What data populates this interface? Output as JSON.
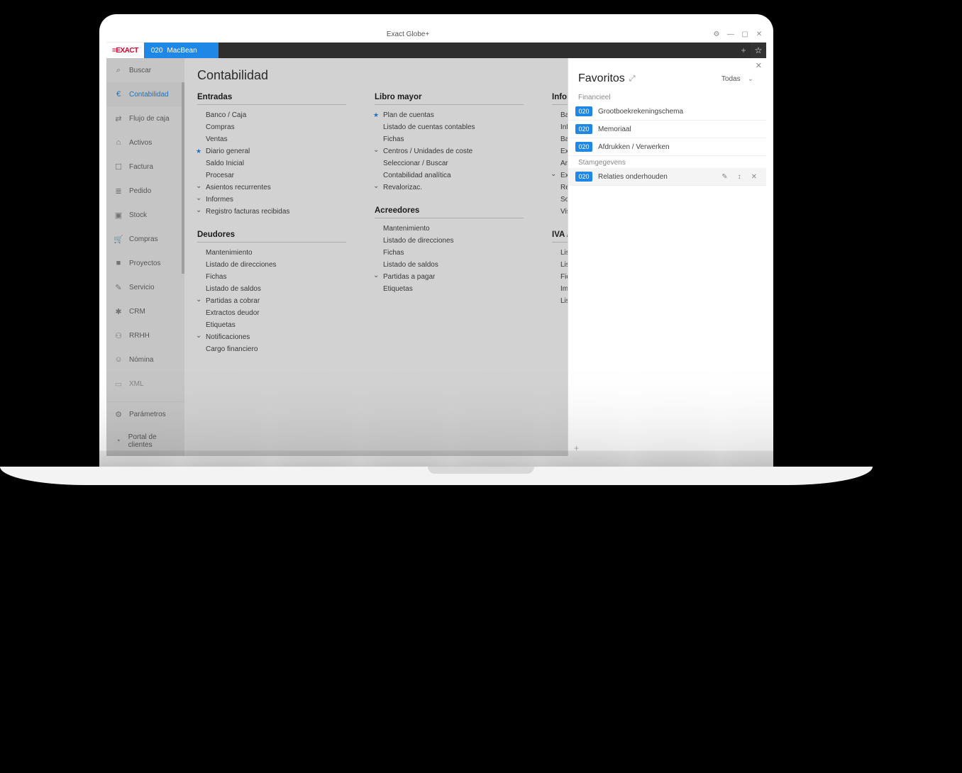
{
  "window": {
    "title": "Exact Globe+",
    "brand": "=EXACT",
    "tab_code": "020",
    "tab_name": "MacBean"
  },
  "sidebar": {
    "search": "Buscar",
    "items": [
      {
        "label": "Contabilidad",
        "icon": "€"
      },
      {
        "label": "Flujo de caja",
        "icon": "⇄"
      },
      {
        "label": "Activos",
        "icon": "⌂"
      },
      {
        "label": "Factura",
        "icon": "☐"
      },
      {
        "label": "Pedido",
        "icon": "≣"
      },
      {
        "label": "Stock",
        "icon": "▣"
      },
      {
        "label": "Compras",
        "icon": "🛒"
      },
      {
        "label": "Proyectos",
        "icon": "■"
      },
      {
        "label": "Servicio",
        "icon": "✎"
      },
      {
        "label": "CRM",
        "icon": "✱"
      },
      {
        "label": "RRHH",
        "icon": "⚇"
      },
      {
        "label": "Nómina",
        "icon": "☺"
      },
      {
        "label": "XML",
        "icon": "▭"
      }
    ],
    "footer": [
      {
        "label": "Parámetros",
        "icon": "⚙"
      },
      {
        "label": "Portal de clientes",
        "icon": "◔"
      }
    ]
  },
  "main": {
    "title": "Contabilidad",
    "col1": {
      "h": "Entradas",
      "items": [
        {
          "t": "Banco / Caja"
        },
        {
          "t": "Compras"
        },
        {
          "t": "Ventas"
        },
        {
          "t": "Diario general",
          "star": true
        },
        {
          "t": "Saldo Inicial"
        },
        {
          "t": "Procesar"
        },
        {
          "t": "Asientos recurrentes",
          "chev": true
        },
        {
          "t": "Informes",
          "chev": true
        },
        {
          "t": "Registro facturas recibidas",
          "chev": true
        }
      ],
      "h2": "Deudores",
      "items2": [
        {
          "t": "Mantenimiento"
        },
        {
          "t": "Listado de direcciones"
        },
        {
          "t": "Fichas"
        },
        {
          "t": "Listado de saldos"
        },
        {
          "t": "Partidas a cobrar",
          "chev": true
        },
        {
          "t": "Extractos deudor"
        },
        {
          "t": "Etiquetas"
        },
        {
          "t": "Notificaciones",
          "chev": true
        },
        {
          "t": "Cargo financiero"
        }
      ]
    },
    "col2": {
      "h": "Libro mayor",
      "items": [
        {
          "t": "Plan de cuentas",
          "star": true
        },
        {
          "t": "Listado de cuentas contables"
        },
        {
          "t": "Fichas"
        },
        {
          "t": "Centros / Unidades de coste",
          "chev": true
        },
        {
          "t": "Seleccionar  / Buscar"
        },
        {
          "t": "Contabilidad analítica"
        },
        {
          "t": "Revalorizac.",
          "chev": true
        }
      ],
      "h2": "Acreedores",
      "items2": [
        {
          "t": "Mantenimiento"
        },
        {
          "t": "Listado de direcciones"
        },
        {
          "t": "Fichas"
        },
        {
          "t": "Listado de saldos"
        },
        {
          "t": "Partidas a pagar",
          "chev": true
        },
        {
          "t": "Etiquetas"
        }
      ]
    },
    "col3": {
      "h": "Inform",
      "items": [
        {
          "t": "Balance"
        },
        {
          "t": "Informe"
        },
        {
          "t": "Balance"
        },
        {
          "t": "Excel Ac"
        },
        {
          "t": "Análisis"
        },
        {
          "t": "Exportar",
          "chev": true
        },
        {
          "t": "Resultad"
        },
        {
          "t": "Solicituc"
        },
        {
          "t": "Vista de"
        }
      ],
      "h2": "IVA /",
      "items2": [
        {
          "t": "Listado"
        },
        {
          "t": "Listado"
        },
        {
          "t": "Fichero"
        },
        {
          "t": "Impuest"
        },
        {
          "t": "Listado"
        }
      ]
    }
  },
  "favorites": {
    "title": "Favoritos",
    "filter": "Todas",
    "groups": [
      {
        "name": "Financieel",
        "items": [
          {
            "code": "020",
            "label": "Grootboekrekeningschema"
          },
          {
            "code": "020",
            "label": "Memoriaal"
          },
          {
            "code": "020",
            "label": "Afdrukken / Verwerken"
          }
        ]
      },
      {
        "name": "Stamgegevens",
        "items": [
          {
            "code": "020",
            "label": "Relaties onderhouden",
            "hover": true
          }
        ]
      }
    ]
  }
}
